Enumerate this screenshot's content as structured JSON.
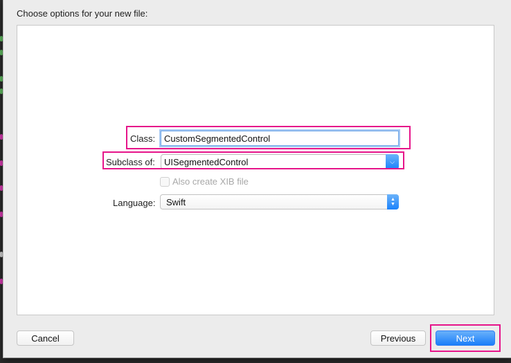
{
  "dialog": {
    "title": "Choose options for your new file:"
  },
  "form": {
    "class_label": "Class:",
    "class_value": "CustomSegmentedControl",
    "subclass_label": "Subclass of:",
    "subclass_value": "UISegmentedControl",
    "xib_label": "Also create XIB file",
    "xib_checked": false,
    "xib_enabled": false,
    "language_label": "Language:",
    "language_value": "Swift"
  },
  "buttons": {
    "cancel": "Cancel",
    "previous": "Previous",
    "next": "Next"
  },
  "colors": {
    "highlight": "#e6148a",
    "accent_blue": "#1b7ef9",
    "sheet_bg": "#ececec"
  }
}
